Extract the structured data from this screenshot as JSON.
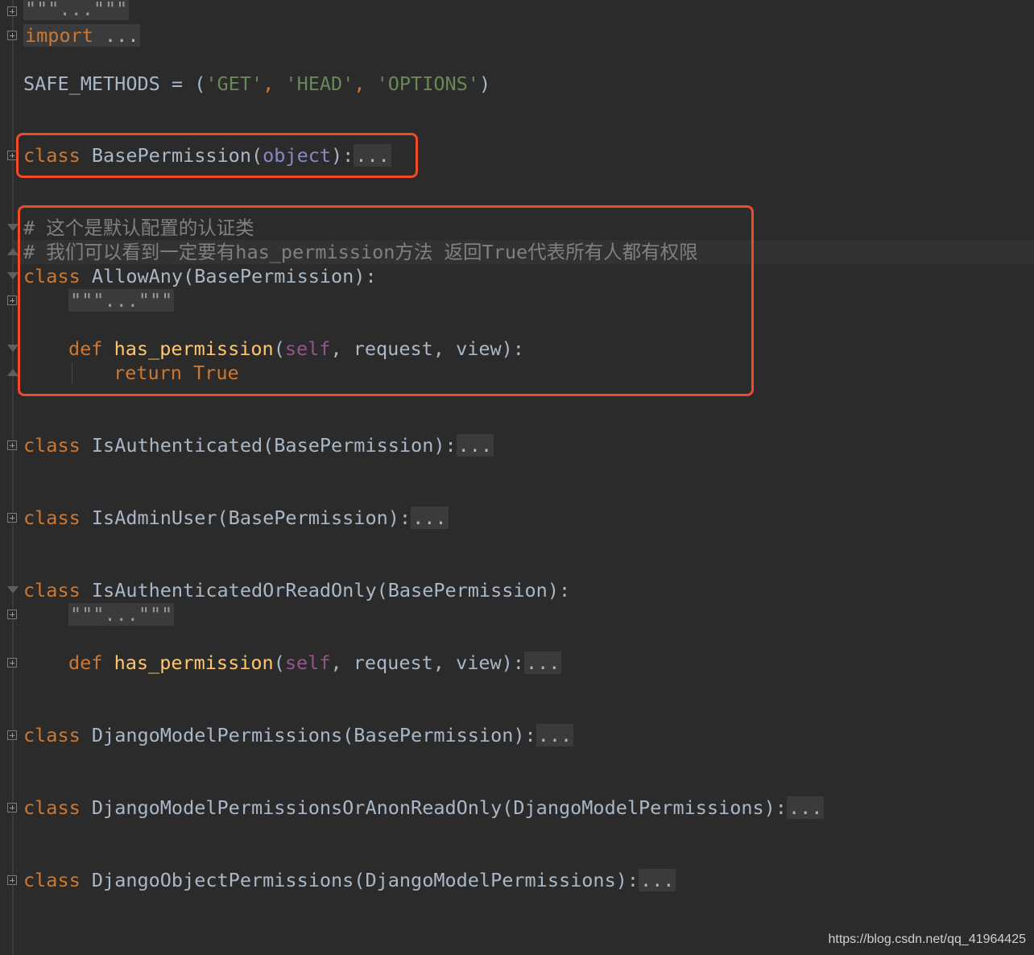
{
  "editor": {
    "lines": {
      "docstring_top": "\"\"\"...\"\"\"",
      "import_kw": "import",
      "import_rest": " ...",
      "safe_methods_name": "SAFE_METHODS = (",
      "str_get": "'GET'",
      "comma1": ", ",
      "str_head": "'HEAD'",
      "comma2": ", ",
      "str_options": "'OPTIONS'",
      "safe_methods_close": ")",
      "basepermission_kw": "class",
      "basepermission_name": " BasePermission(",
      "basepermission_object": "object",
      "basepermission_close": "):",
      "basepermission_dots": "...",
      "comment1": "# 这个是默认配置的认证类",
      "comment2": "# 我们可以看到一定要有has_permission方法 返回True代表所有人都有权限",
      "allowany_kw": "class",
      "allowany_name": " AllowAny(BasePermission):",
      "allowany_doc": "\"\"\"...\"\"\"",
      "def_kw": "def",
      "def_fn": " has_permission",
      "def_open": "(",
      "def_self": "self",
      "def_args": ", request, view):",
      "return_kw": "return",
      "return_val": " True",
      "isauth_kw": "class",
      "isauth_name": " IsAuthenticated(BasePermission):",
      "isauth_dots": "...",
      "isadmin_kw": "class",
      "isadmin_name": " IsAdminUser(BasePermission):",
      "isadmin_dots": "...",
      "isauthro_kw": "class",
      "isauthro_name": " IsAuthenticatedOrReadOnly(BasePermission):",
      "isauthro_doc": "\"\"\"...\"\"\"",
      "def2_kw": "def",
      "def2_fn": " has_permission",
      "def2_open": "(",
      "def2_self": "self",
      "def2_args": ", request, view):",
      "def2_dots": "...",
      "djmodel_kw": "class",
      "djmodel_name": " DjangoModelPermissions(BasePermission):",
      "djmodel_dots": "...",
      "djanon_kw": "class",
      "djanon_name": " DjangoModelPermissionsOrAnonReadOnly(DjangoModelPermissions):",
      "djanon_dots": "...",
      "djobj_kw": "class",
      "djobj_name": " DjangoObjectPermissions(DjangoModelPermissions):",
      "djobj_dots": "..."
    }
  },
  "watermark": "https://blog.csdn.net/qq_41964425",
  "colors": {
    "background": "#2b2b2b",
    "keyword": "#cc7832",
    "function": "#ffc66d",
    "string": "#6a8759",
    "self": "#94558d",
    "comment": "#808080",
    "annotation_box": "#f04a2a"
  }
}
